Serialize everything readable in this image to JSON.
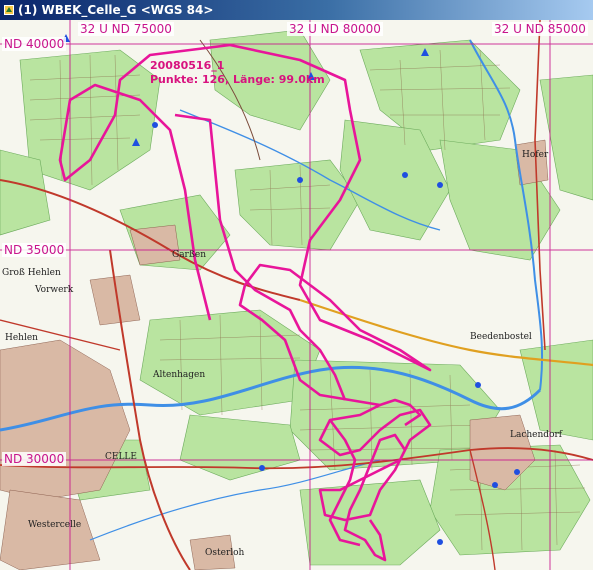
{
  "window": {
    "title": "(1) WBEK_Celle_G <WGS 84>"
  },
  "grid_labels": {
    "top": [
      "32 U ND 75000",
      "32 U ND 80000",
      "32 U ND 85000"
    ],
    "left": [
      "ND 40000",
      "ND 35000",
      "ND 30000"
    ]
  },
  "track": {
    "name": "20080516_1",
    "stats": "Punkte: 126, Länge: 99.0km"
  },
  "places": {
    "hofer": "Hofer",
    "beedenbostel": "Beedenbostel",
    "lachendorf": "Lachendorf",
    "celle": "CELLE",
    "westercelle": "Westercelle",
    "altenhagen": "Altenhagen",
    "garssen": "Garßen",
    "vorwerk": "Vorwerk",
    "gross_hehlen": "Groß Hehlen",
    "hehlen": "Hehlen",
    "osterloh": "Osterloh"
  },
  "colors": {
    "title_bar": "#0a246a",
    "track": "#e8159a",
    "grid": "#c8148c",
    "forest": "#b9e4a0",
    "waypoint": "#1f4fe0"
  }
}
